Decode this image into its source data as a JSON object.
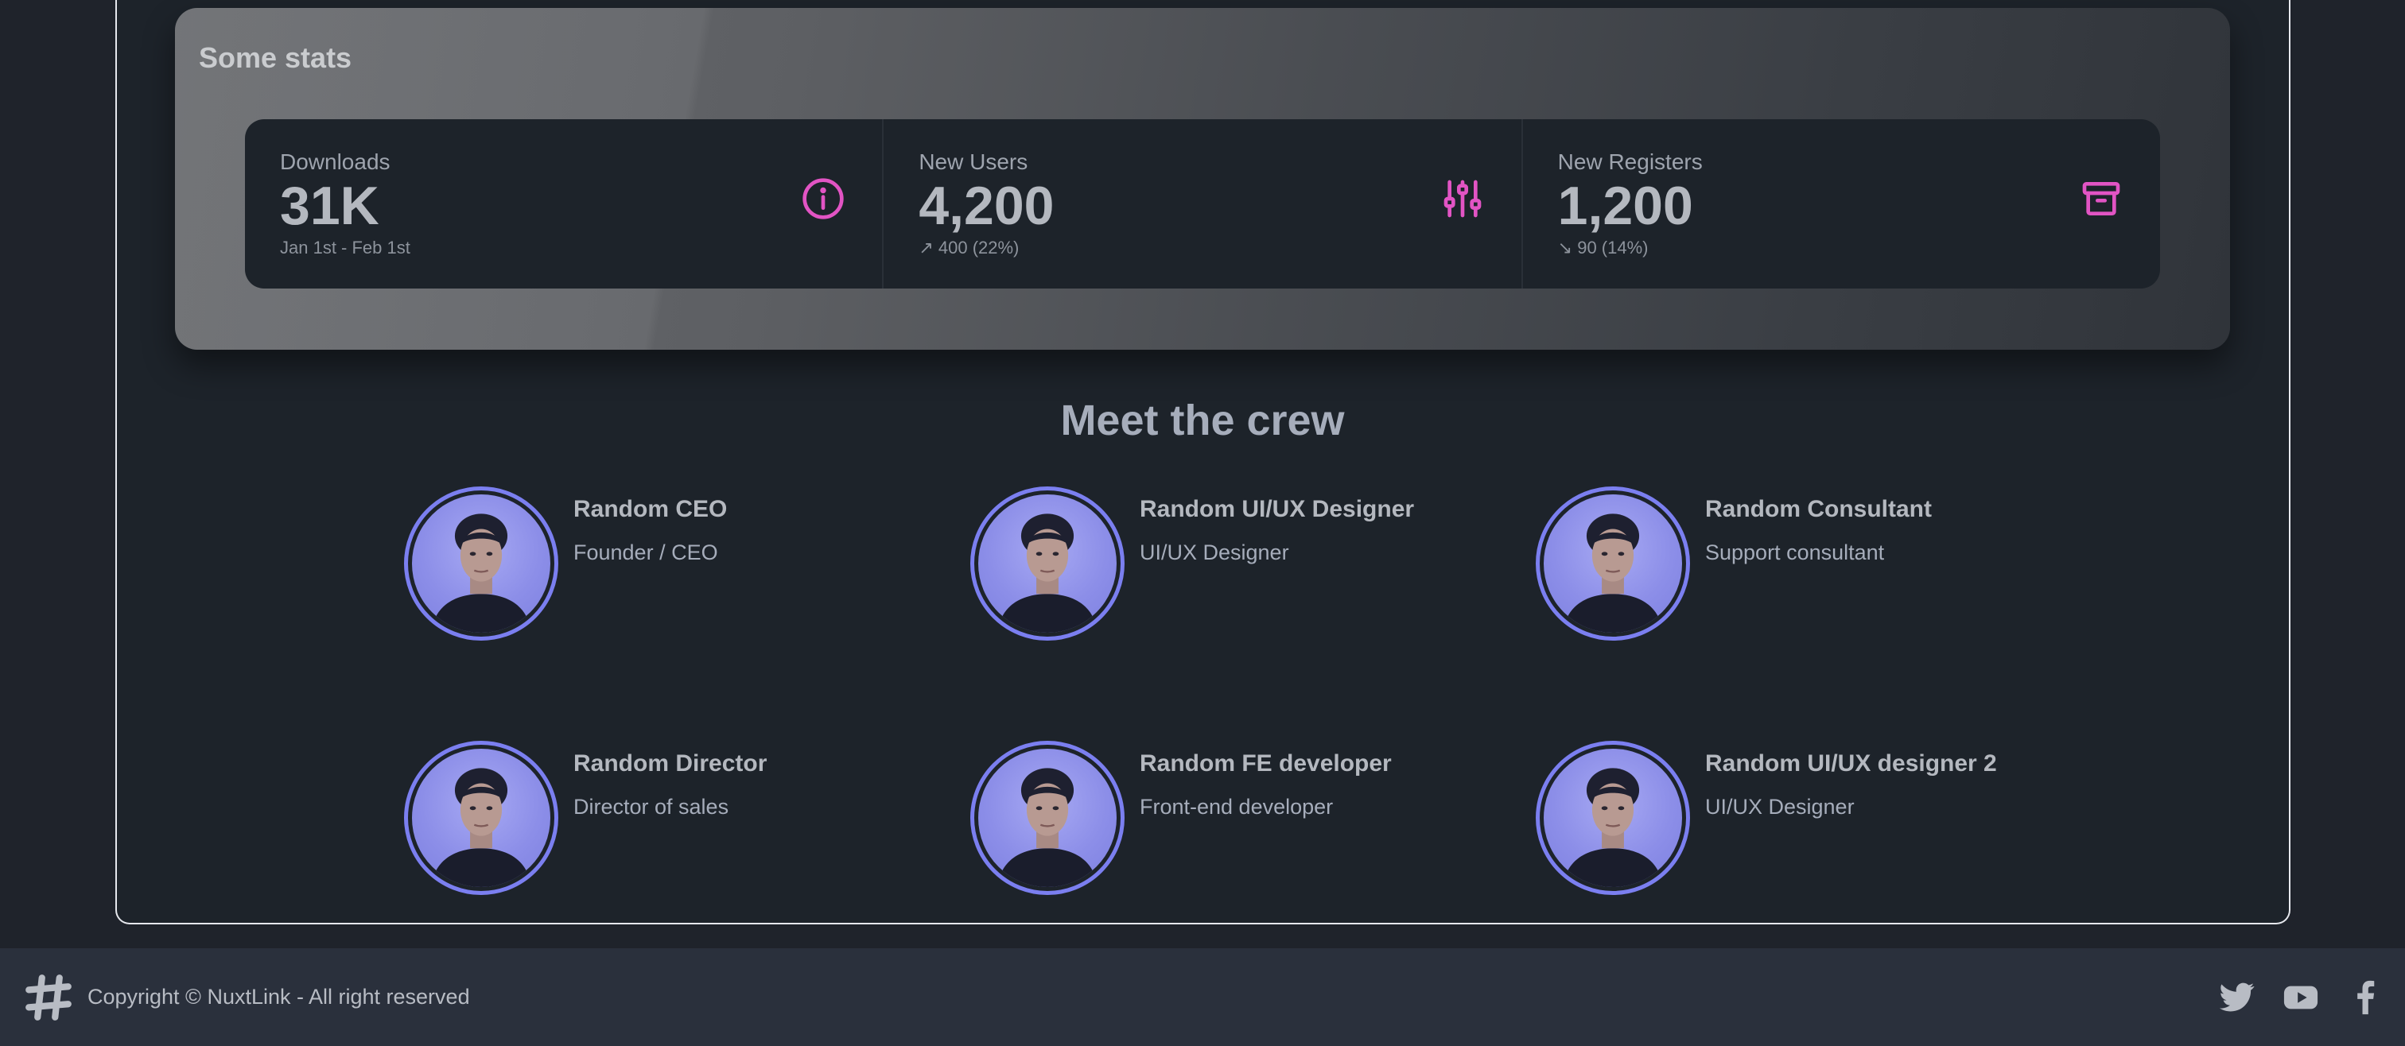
{
  "stats": {
    "title": "Some stats",
    "items": [
      {
        "title": "Downloads",
        "value": "31K",
        "desc": "Jan 1st - Feb 1st",
        "icon": "info-icon"
      },
      {
        "title": "New Users",
        "value": "4,200",
        "desc": "↗ 400 (22%)",
        "icon": "adjustments-icon"
      },
      {
        "title": "New Registers",
        "value": "1,200",
        "desc": "↘ 90 (14%)",
        "icon": "archive-icon"
      }
    ],
    "accent": "#e254c4"
  },
  "crew": {
    "title": "Meet the crew",
    "members": [
      {
        "name": "Random CEO",
        "role": "Founder / CEO"
      },
      {
        "name": "Random UI/UX Designer",
        "role": "UI/UX Designer"
      },
      {
        "name": "Random Consultant",
        "role": "Support consultant"
      },
      {
        "name": "Random Director",
        "role": "Director of sales"
      },
      {
        "name": "Random FE developer",
        "role": "Front-end developer"
      },
      {
        "name": "Random UI/UX designer 2",
        "role": "UI/UX Designer"
      }
    ],
    "avatar_ring_color": "#7b7ff0"
  },
  "footer": {
    "copyright": "Copyright © NuxtLink - All right reserved",
    "logo_icon": "hashtag-logo-icon",
    "social": [
      "twitter-icon",
      "youtube-icon",
      "facebook-icon"
    ]
  }
}
